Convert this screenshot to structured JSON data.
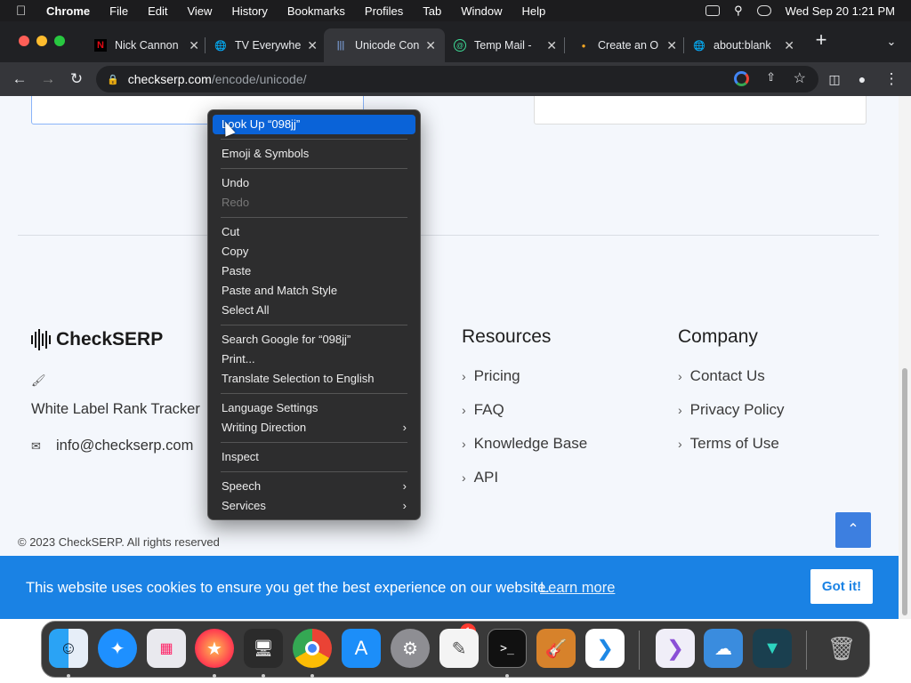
{
  "menubar": {
    "app": "Chrome",
    "items": [
      "File",
      "Edit",
      "View",
      "History",
      "Bookmarks",
      "Profiles",
      "Tab",
      "Window",
      "Help"
    ],
    "datetime": "Wed Sep 20  1:21 PM"
  },
  "tabs": [
    {
      "title": "Nick Cannon",
      "icon": "netflix-icon"
    },
    {
      "title": "TV Everywhe",
      "icon": "globe-icon"
    },
    {
      "title": "Unicode Con",
      "icon": "soundwave-icon",
      "active": true
    },
    {
      "title": "Temp Mail -",
      "icon": "tempmail-icon"
    },
    {
      "title": "Create an O",
      "icon": "dot-icon"
    },
    {
      "title": "about:blank",
      "icon": "globe-icon"
    }
  ],
  "address": {
    "host": "checkserp.com",
    "path": "/encode/unicode/"
  },
  "footer": {
    "brand": "CheckSERP",
    "tagline": "White Label Rank Tracker",
    "email": "info@checkserp.com",
    "resources_heading": "Resources",
    "resources": [
      "Pricing",
      "FAQ",
      "Knowledge Base",
      "API"
    ],
    "company_heading": "Company",
    "company": [
      "Contact Us",
      "Privacy Policy",
      "Terms of Use"
    ],
    "copyright": "© 2023 CheckSERP. All rights reserved"
  },
  "cookie": {
    "message": "This website uses cookies to ensure you get the best experience on our website.",
    "learn_more": "Learn more",
    "button": "Got it!"
  },
  "context_menu": {
    "look_up": "Look Up “098jj”",
    "emoji": "Emoji & Symbols",
    "undo": "Undo",
    "redo": "Redo",
    "cut": "Cut",
    "copy": "Copy",
    "paste": "Paste",
    "paste_match": "Paste and Match Style",
    "select_all": "Select All",
    "search_google": "Search Google for “098jj”",
    "print": "Print...",
    "translate": "Translate Selection to English",
    "language_settings": "Language Settings",
    "writing_direction": "Writing Direction",
    "inspect": "Inspect",
    "speech": "Speech",
    "services": "Services"
  },
  "dock": {
    "settings_badge": "1"
  },
  "colors": {
    "accent": "#1a82e4",
    "menu_highlight": "#0a63d8"
  }
}
